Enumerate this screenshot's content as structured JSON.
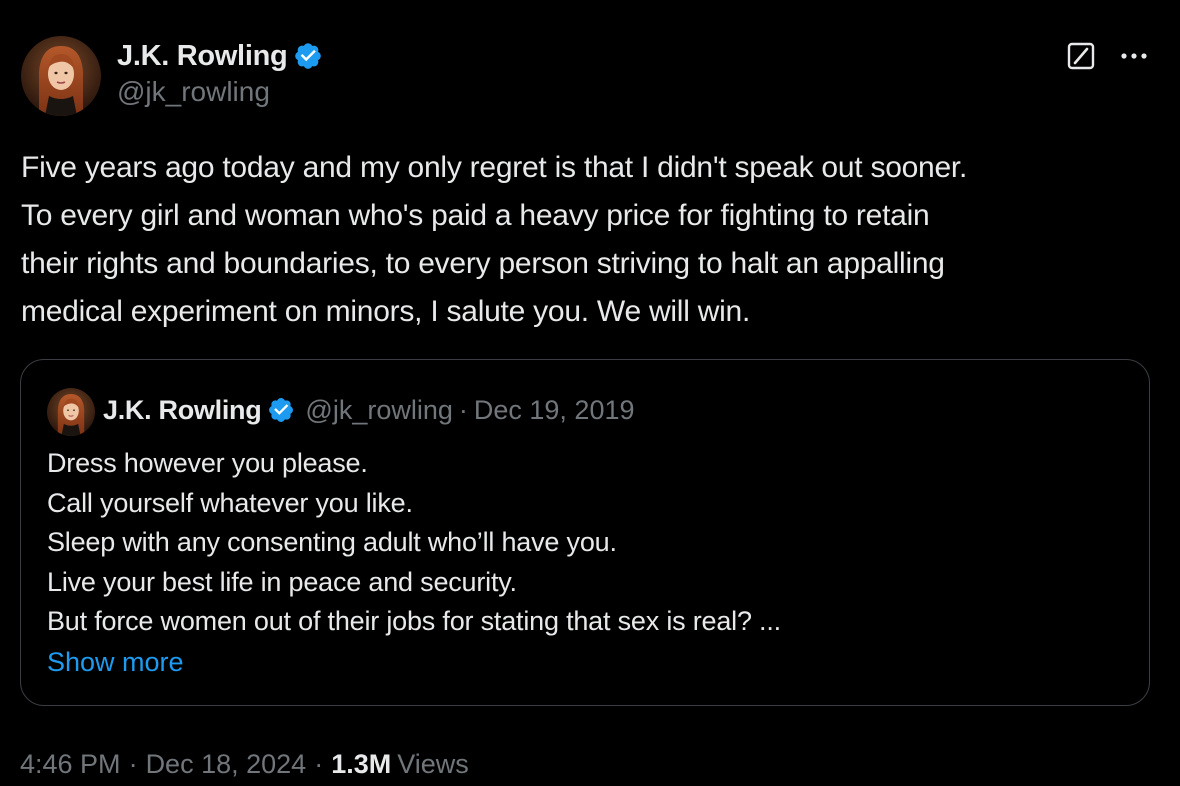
{
  "colors": {
    "background": "#000000",
    "text_primary": "#e7e9ea",
    "text_secondary": "#71767b",
    "accent": "#1d9bf0",
    "border": "#3a3e42",
    "verified": "#1d9bf0"
  },
  "author": {
    "name": "J.K. Rowling",
    "handle": "@jk_rowling",
    "verified_icon": "verified-badge-icon",
    "avatar_icon": "avatar"
  },
  "header_actions": {
    "grok_icon": "grok-icon",
    "more_icon": "more-icon"
  },
  "tweet": {
    "text": "Five years ago today and my only regret is that I didn't speak out sooner.\nTo every girl and woman who's paid a heavy price for fighting to retain\ntheir rights and boundaries, to every person striving to halt an appalling\nmedical experiment on minors, I salute you. We will win."
  },
  "quoted_tweet": {
    "name": "J.K. Rowling",
    "handle": "@jk_rowling",
    "separator": "·",
    "date": "Dec 19, 2019",
    "lines": [
      "Dress however you please.",
      "Call yourself whatever you like.",
      "Sleep with any consenting adult who’ll have you.",
      "Live your best life in peace and security.",
      "But force women out of their jobs for stating that sex is real? ..."
    ],
    "show_more": "Show more"
  },
  "meta": {
    "time": "4:46 PM",
    "separator": "·",
    "date": "Dec 18, 2024",
    "views_count": "1.3M",
    "views_label": "Views"
  }
}
